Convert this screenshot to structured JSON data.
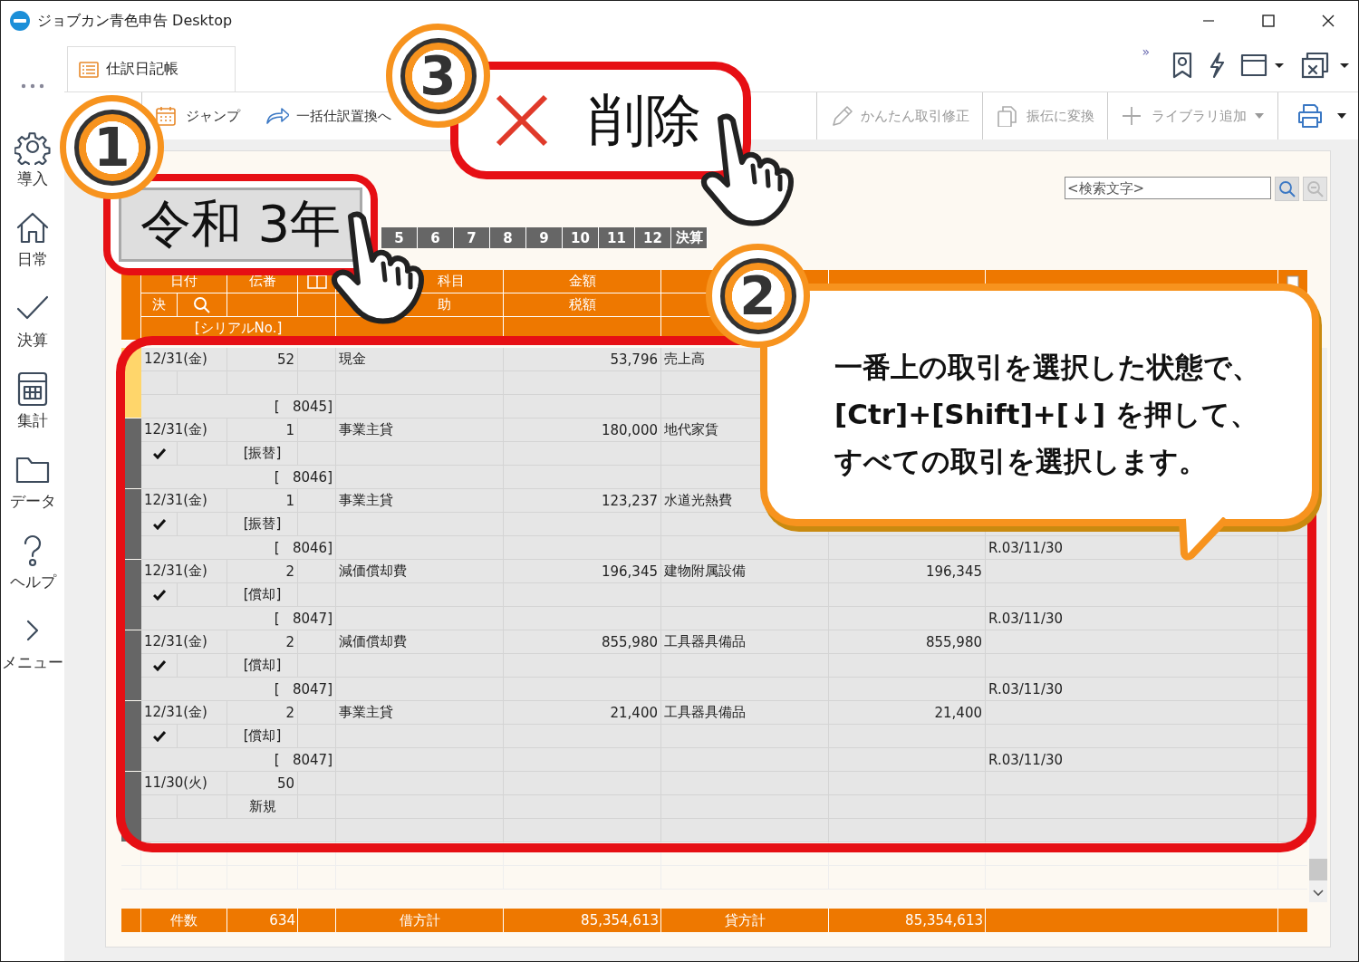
{
  "window": {
    "title": "ジョブカン青色申告 Desktop"
  },
  "sidebar": {
    "items": [
      {
        "label": "導入"
      },
      {
        "label": "日常"
      },
      {
        "label": "決算"
      },
      {
        "label": "集計"
      },
      {
        "label": "データ"
      },
      {
        "label": "ヘルプ"
      },
      {
        "label": "メニュー"
      }
    ]
  },
  "tabs": [
    {
      "label": "仕訳日記帳",
      "selected": true
    }
  ],
  "top_tools": {
    "overflow": "»"
  },
  "toolbar": [
    {
      "label": "ジャンプ",
      "disabled": false
    },
    {
      "label": "一括仕訳置換へ",
      "disabled": false
    },
    {
      "label": "かんたん取引修正",
      "disabled": true
    },
    {
      "label": "振伝に変換",
      "disabled": true
    },
    {
      "label": "ライブラリ追加",
      "disabled": true
    }
  ],
  "search": {
    "placeholder": "<検索文字>"
  },
  "year": {
    "label": "令和 3年"
  },
  "months": [
    {
      "label": "5"
    },
    {
      "label": "6"
    },
    {
      "label": "7"
    },
    {
      "label": "8"
    },
    {
      "label": "9"
    },
    {
      "label": "10"
    },
    {
      "label": "11"
    },
    {
      "label": "12"
    },
    {
      "label": "決算"
    }
  ],
  "table": {
    "header": {
      "date": "日付",
      "voucher": "伝番",
      "account": "科目",
      "amount": "金額",
      "settle": "決",
      "sub": "助",
      "tax": "税額",
      "serial": "[シリアルNo.]"
    },
    "entries": [
      {
        "date": "12/31(金)",
        "voucher_no": "52",
        "debit_account": "現金",
        "debit_amount": "53,796",
        "credit_account": "売上高",
        "serial": "[   8045]",
        "checked": false,
        "selected": true,
        "current": true
      },
      {
        "date": "12/31(金)",
        "voucher_no": "1",
        "debit_account": "事業主貸",
        "debit_amount": "180,000",
        "credit_account": "地代家賃",
        "tag": "[振替]",
        "serial": "[   8046]",
        "checked": true,
        "selected": true,
        "current": false
      },
      {
        "date": "12/31(金)",
        "voucher_no": "1",
        "debit_account": "事業主貸",
        "debit_amount": "123,237",
        "credit_account": "水道光熱費",
        "tag": "[振替]",
        "serial": "[   8046]",
        "memo_date": "R.03/11/30",
        "checked": true,
        "selected": true,
        "current": false
      },
      {
        "date": "12/31(金)",
        "voucher_no": "2",
        "debit_account": "減価償却費",
        "debit_amount": "196,345",
        "credit_account": "建物附属設備",
        "credit_amount": "196,345",
        "tag": "[償却]",
        "serial": "[   8047]",
        "memo_date": "R.03/11/30",
        "checked": true,
        "selected": true,
        "current": false
      },
      {
        "date": "12/31(金)",
        "voucher_no": "2",
        "debit_account": "減価償却費",
        "debit_amount": "855,980",
        "credit_account": "工具器具備品",
        "credit_amount": "855,980",
        "tag": "[償却]",
        "serial": "[   8047]",
        "memo_date": "R.03/11/30",
        "checked": true,
        "selected": true,
        "current": false
      },
      {
        "date": "12/31(金)",
        "voucher_no": "2",
        "debit_account": "事業主貸",
        "debit_amount": "21,400",
        "credit_account": "工具器具備品",
        "credit_amount": "21,400",
        "tag": "[償却]",
        "serial": "[   8047]",
        "memo_date": "R.03/11/30",
        "checked": true,
        "selected": true,
        "current": false
      },
      {
        "date": "11/30(火)",
        "voucher_no": "50",
        "tag": "新規",
        "checked": false,
        "selected": true,
        "current": false
      }
    ],
    "footer": {
      "count_label": "件数",
      "count": "634",
      "debit_label": "借方計",
      "debit_total": "85,354,613",
      "credit_label": "貸方計",
      "credit_total": "85,354,613"
    }
  },
  "annotations": {
    "markers": [
      {
        "number": "1"
      },
      {
        "number": "2"
      },
      {
        "number": "3"
      }
    ],
    "delete_button": {
      "label": "削除"
    },
    "note_lines": [
      "一番上の取引を選択した状態で、",
      "[Ctr]+[Shift]+[↓] を押して、",
      "すべての取引を選択します。"
    ]
  }
}
